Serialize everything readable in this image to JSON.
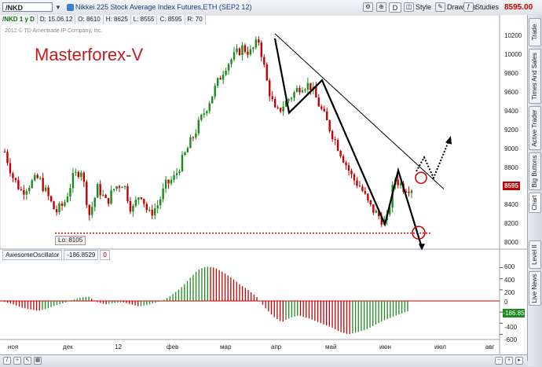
{
  "toolbar": {
    "symbol": "/NKD",
    "title": "Nikkei 225 Stock Average Index Futures,ETH (SEP2 12)",
    "style_label": "Style",
    "drawings_label": "Drawings",
    "studies_label": "Studies",
    "last_price": "8595.00",
    "d_label": "D"
  },
  "infobar": {
    "symbol": "/NKD 1 y D",
    "date": "D: 15.06.12",
    "open": "O: 8610",
    "high": "H: 8625",
    "low": "L: 8555",
    "close": "C: 8595",
    "range": "R: 70"
  },
  "copyright": "2012 © TD Ameritrade IP Company, Inc.",
  "brand": "Masterforex-V",
  "lo_label": "Lo: 8105",
  "price_tag": "8595",
  "oscillator": {
    "name": "AwesomeOscillator",
    "value": "-186.8529",
    "zero": "0",
    "tag": "-186.85"
  },
  "y_axis": [
    "10200",
    "10000",
    "9800",
    "9600",
    "9400",
    "9200",
    "9000",
    "8800",
    "8400",
    "8200",
    "8000"
  ],
  "osc_axis": [
    "600",
    "400",
    "200",
    "0",
    "-200",
    "-400",
    "-600"
  ],
  "x_axis": [
    "ноя",
    "дек",
    "12",
    "фев",
    "мар",
    "апр",
    "май",
    "июн",
    "июл",
    "авг"
  ],
  "sidebar": [
    "Trade",
    "Times And Sales",
    "Active Trader",
    "Big Buttons",
    "Chart",
    "Level II",
    "Live News"
  ],
  "colors": {
    "up": "#1c8a1c",
    "down": "#c40000",
    "trendline": "#000000",
    "support": "#c40000"
  },
  "chart_data": {
    "type": "candlestick",
    "price_low": 8105,
    "last_close": 8595,
    "path_closes": [
      8980,
      8700,
      8550,
      8640,
      8700,
      8520,
      8330,
      8420,
      8690,
      8800,
      8300,
      8600,
      8430,
      8600,
      8650,
      8340,
      8550,
      8300,
      8400,
      8620,
      8700,
      8900,
      9100,
      9300,
      9500,
      9700,
      9900,
      10000,
      10100,
      10050,
      10180,
      9700,
      9380,
      9500,
      9600,
      9700,
      9700,
      9500,
      9300,
      9100,
      8900,
      8700,
      8600,
      8400,
      8300,
      8200,
      8700,
      8600,
      8595
    ],
    "osc_values": [
      -20,
      -60,
      -120,
      -150,
      -180,
      -140,
      -80,
      -40,
      20,
      60,
      80,
      -20,
      -60,
      -40,
      -20,
      -60,
      -100,
      -70,
      -30,
      20,
      120,
      240,
      400,
      560,
      620,
      600,
      520,
      420,
      300,
      200,
      80,
      -120,
      -280,
      -380,
      -300,
      -260,
      -300,
      -360,
      -420,
      -480,
      -560,
      -600,
      -560,
      -520,
      -440,
      -360,
      -300,
      -240,
      -187
    ]
  }
}
